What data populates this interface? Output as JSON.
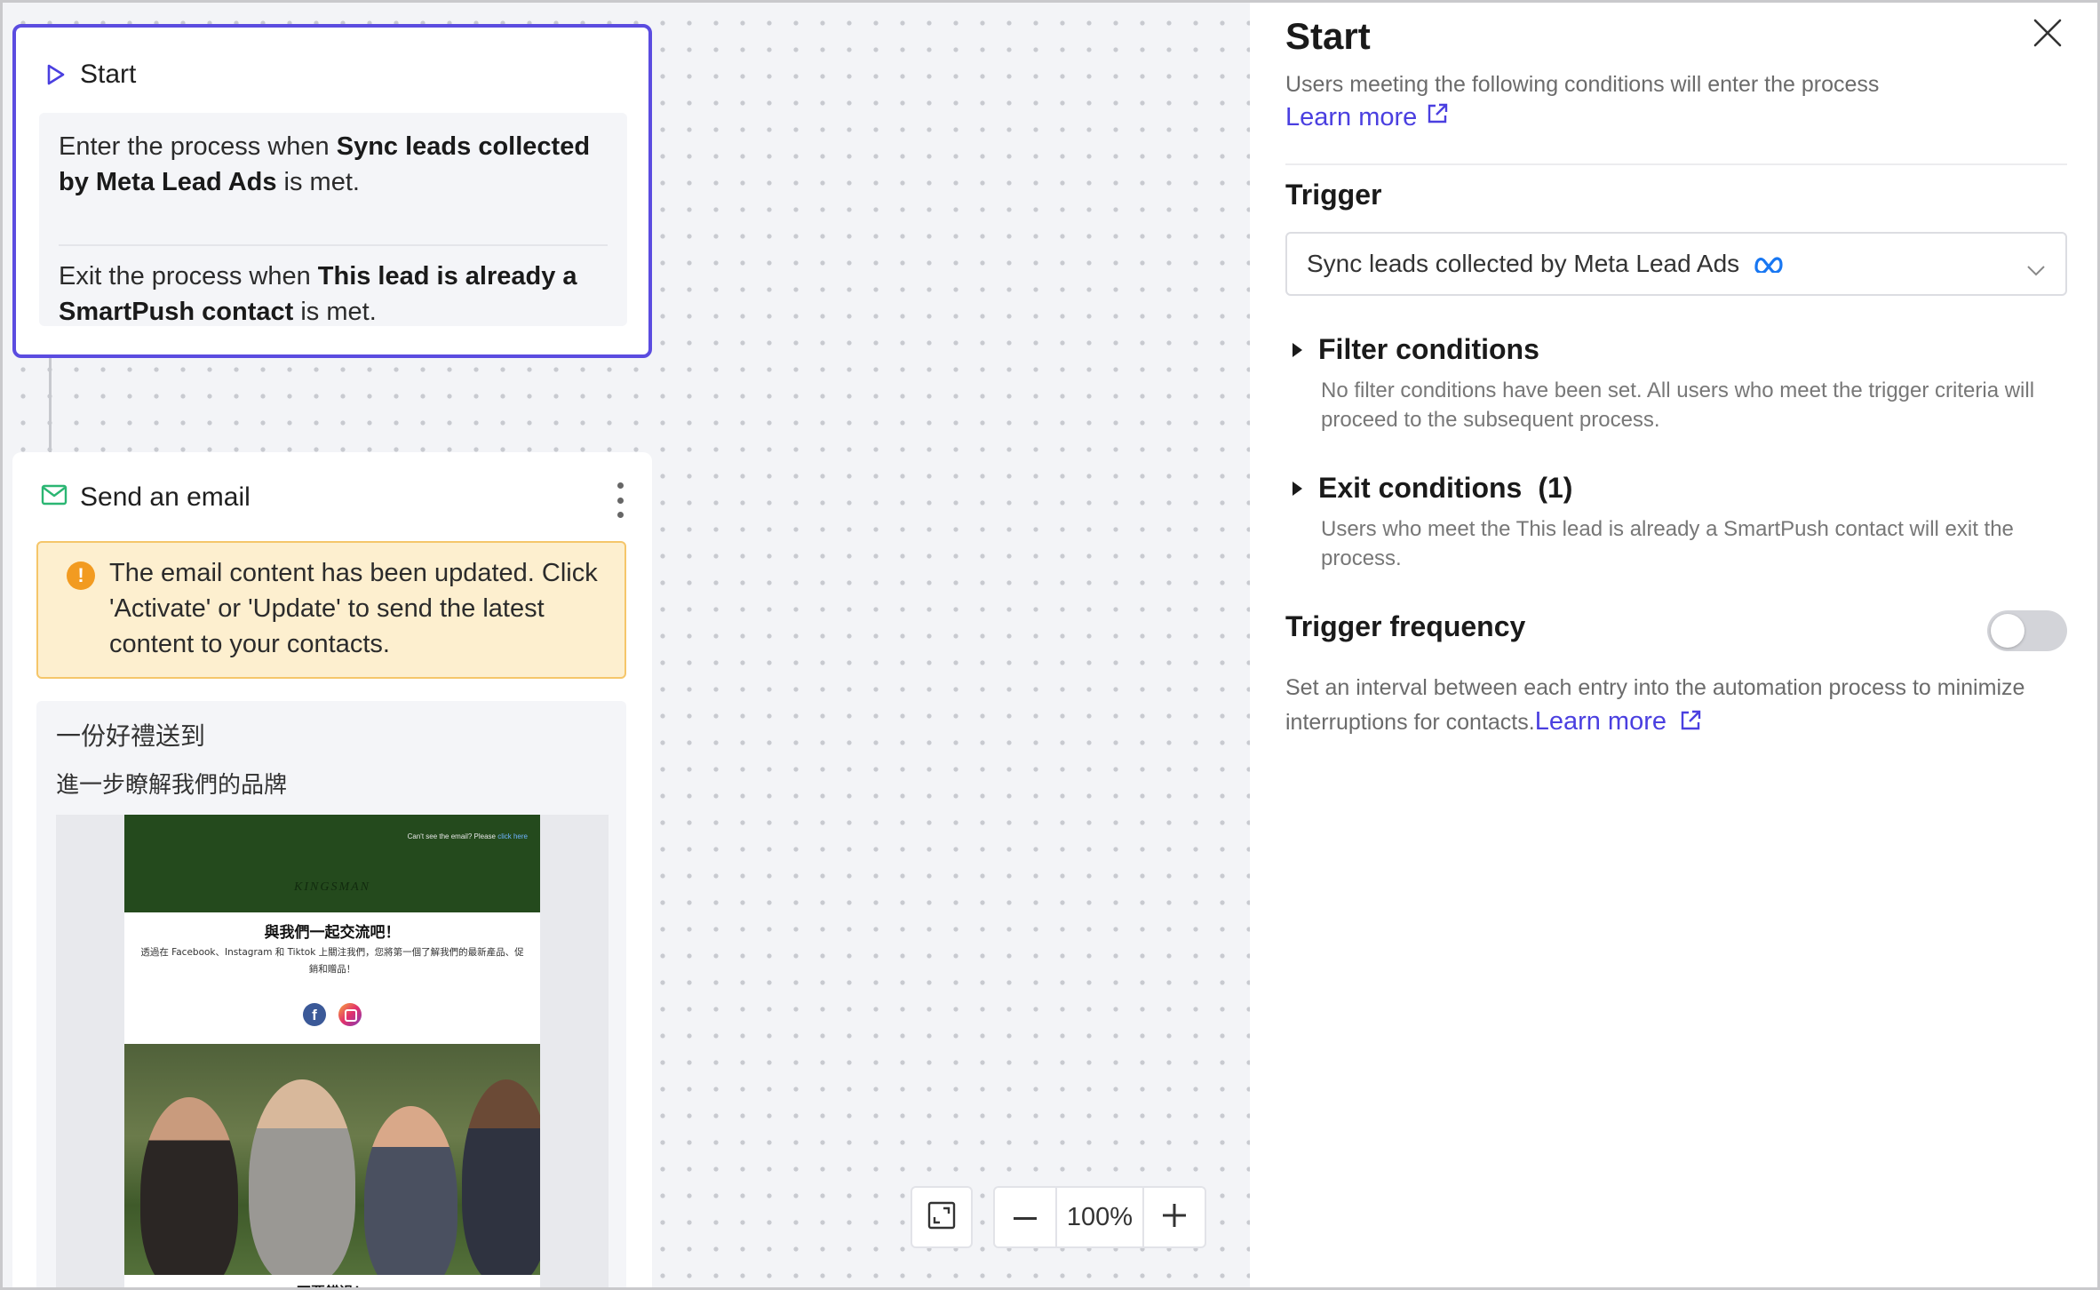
{
  "canvas": {
    "start_node": {
      "title": "Start",
      "enter_prefix": "Enter the process when ",
      "enter_trigger": "Sync leads collected by Meta Lead Ads",
      "enter_suffix": " is met.",
      "exit_prefix": "Exit the process when ",
      "exit_trigger": "This lead is already a SmartPush contact",
      "exit_suffix": " is met."
    },
    "email_node": {
      "title": "Send an email",
      "warning": "The email content has been updated. Click 'Activate' or 'Update' to send the latest content to your contacts.",
      "preview_title": "一份好禮送到",
      "preview_subtitle": "進一步瞭解我們的品牌",
      "thumb_top_note": "Can't see the email? Please ",
      "thumb_top_link": "click here",
      "thumb_brand": "KINGSMAN",
      "thumb_heading": "與我們一起交流吧！",
      "thumb_body": "透過在 Facebook、Instagram 和 Tiktok 上關注我們，您將第一個了解我們的最新產品、促銷和贈品！",
      "thumb_footer": "不要錯過！"
    },
    "zoom": {
      "value": "100%"
    }
  },
  "panel": {
    "title": "Start",
    "description": "Users meeting the following conditions will enter the process",
    "learn_more": "Learn more",
    "trigger_title": "Trigger",
    "trigger_value": "Sync leads collected by Meta Lead Ads",
    "filter_title": "Filter conditions",
    "filter_desc": "No filter conditions have been set. All users who meet the trigger criteria will proceed to the subsequent process.",
    "exit_title": "Exit conditions",
    "exit_count": "(1)",
    "exit_desc": "Users who meet the This lead is already a SmartPush contact will exit the process.",
    "frequency_title": "Trigger frequency",
    "frequency_enabled": false,
    "frequency_desc": "Set an interval between each entry into the automation process to minimize interruptions for contacts.",
    "frequency_learn_more": "Learn more"
  },
  "colors": {
    "accent": "#4a3fe0",
    "node_border": "#5b4ce0",
    "warning_bg": "#fdefcf",
    "warning_icon": "#f29b21",
    "email_icon": "#2bb673"
  }
}
